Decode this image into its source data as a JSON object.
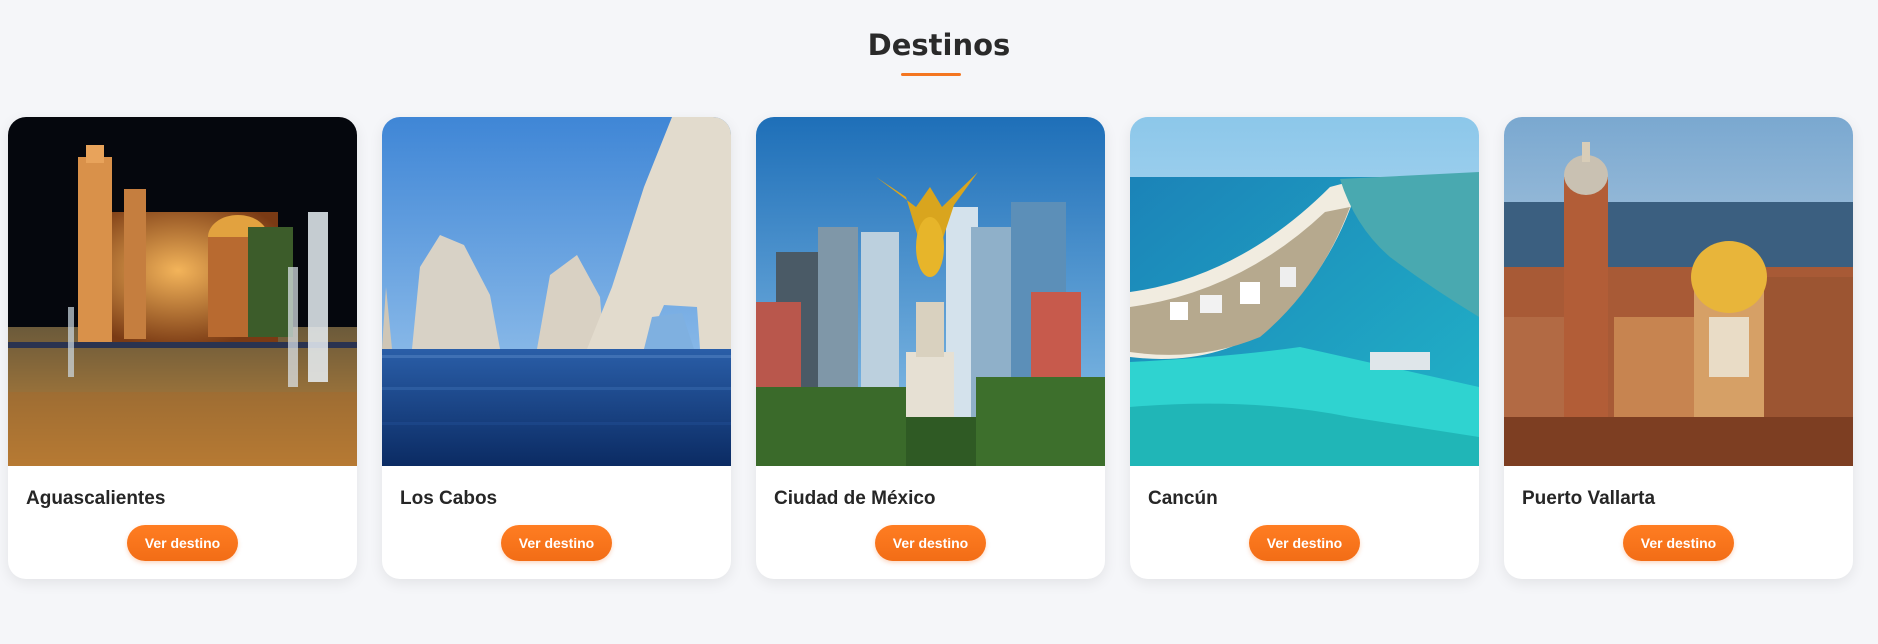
{
  "section": {
    "title": "Destinos",
    "accent": "#f47621"
  },
  "cards": [
    {
      "title": "Aguascalientes",
      "button": "Ver destino",
      "image": "night cathedral with fountains"
    },
    {
      "title": "Los Cabos",
      "button": "Ver destino",
      "image": "rock arch over sea"
    },
    {
      "title": "Ciudad de México",
      "button": "Ver destino",
      "image": "Angel of Independence with skyline"
    },
    {
      "title": "Cancún",
      "button": "Ver destino",
      "image": "aerial hotel zone turquoise sea"
    },
    {
      "title": "Puerto Vallarta",
      "button": "Ver destino",
      "image": "church with crown dome over town"
    }
  ],
  "colors": {
    "background": "#f5f6f9",
    "card": "#ffffff",
    "button": "#f47621",
    "button_text": "#ffffff"
  }
}
